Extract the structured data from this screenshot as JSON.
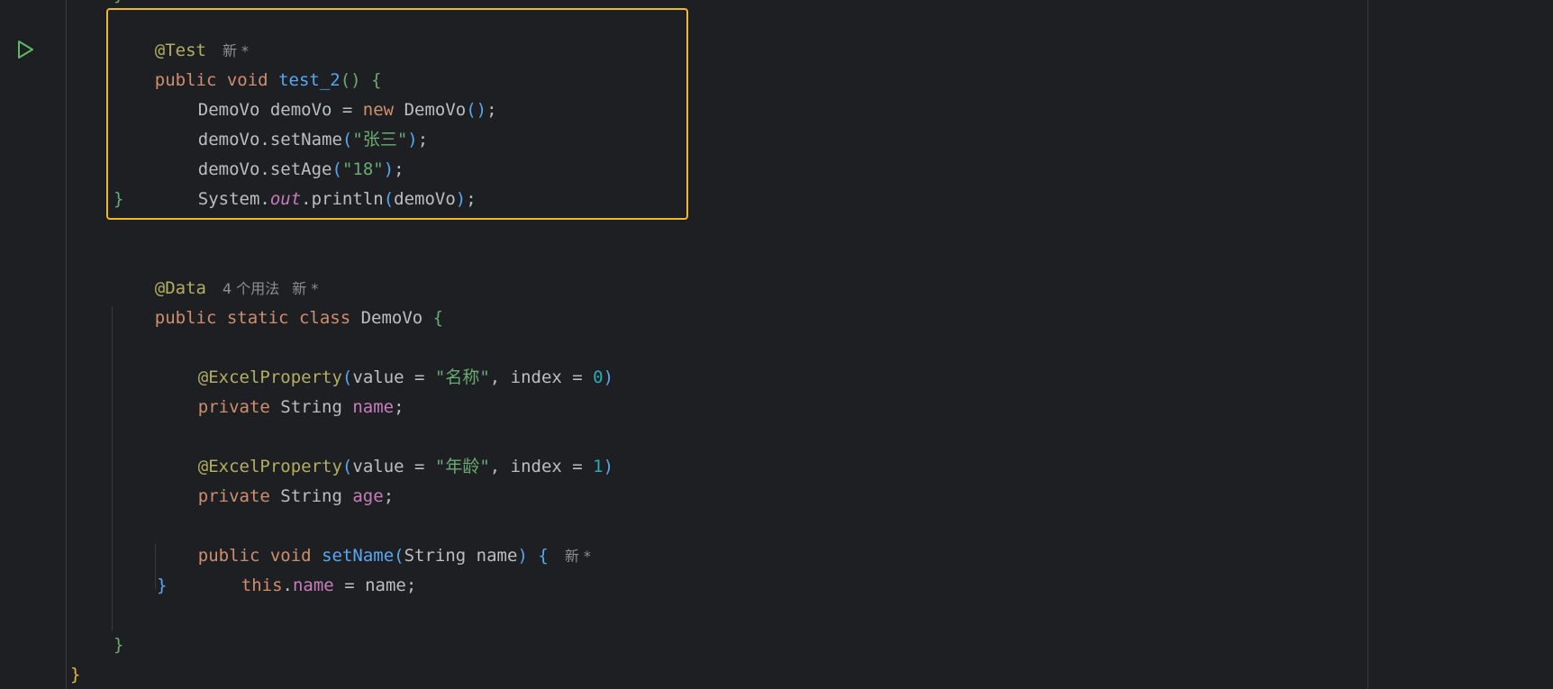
{
  "editor": {
    "top_stub": "}",
    "method": {
      "annotation": "@Test",
      "annotation_hint": "新 *",
      "kw_public": "public",
      "kw_void": "void",
      "name": "test_2",
      "parens": "()",
      "brace_open": "{",
      "line1": {
        "type": "DemoVo",
        "var": " demoVo = ",
        "kw_new": "new",
        "ctor": " DemoVo",
        "parens": "()",
        "semi": ";"
      },
      "line2": {
        "recv": "demoVo.setName",
        "open": "(",
        "arg": "\"张三\"",
        "close": ")",
        "semi": ";"
      },
      "line3": {
        "recv": "demoVo.setAge",
        "open": "(",
        "arg": "\"18\"",
        "close": ")",
        "semi": ";"
      },
      "line4": {
        "cls": "System.",
        "field": "out",
        "call": ".println",
        "open": "(",
        "arg": "demoVo",
        "close": ")",
        "semi": ";"
      },
      "brace_close": "}"
    },
    "klass": {
      "annotation": "@Data",
      "usages_hint": "4 个用法",
      "new_hint": "新 *",
      "kw_public": "public",
      "kw_static": "static",
      "kw_class": "class",
      "name": " DemoVo ",
      "brace_open": "{",
      "prop1": {
        "annotation": "@ExcelProperty",
        "open": "(",
        "param1": "value = ",
        "value": "\"名称\"",
        "param2": ", index = ",
        "index": "0",
        "close": ")"
      },
      "field1": {
        "kw": "private",
        "type": " String ",
        "name": "name",
        "semi": ";"
      },
      "prop2": {
        "annotation": "@ExcelProperty",
        "open": "(",
        "param1": "value = ",
        "value": "\"年龄\"",
        "param2": ", index = ",
        "index": "1",
        "close": ")"
      },
      "field2": {
        "kw": "private",
        "type": " String ",
        "name": "age",
        "semi": ";"
      },
      "setter": {
        "kw_public": "public",
        "kw_void": "void",
        "name": "setName",
        "open": "(",
        "params": "String name",
        "close": ")",
        "brace_open": "{",
        "hint": "新 *",
        "body": {
          "kw_this": "this",
          "dot": ".",
          "field": "name",
          "rest": " = name;"
        },
        "brace_close": "}"
      },
      "brace_close": "}"
    },
    "outer_brace_close": "}"
  },
  "colors": {
    "background": "#1e1f22",
    "keyword": "#cf8e6d",
    "annotation": "#b3ae60",
    "function": "#56a8f5",
    "string": "#6aab73",
    "number": "#2aacb8",
    "field": "#c77dbb",
    "highlight": "#f0b92a",
    "run_icon": "#5fb865"
  },
  "icons": {
    "run": "run-gutter-icon"
  }
}
